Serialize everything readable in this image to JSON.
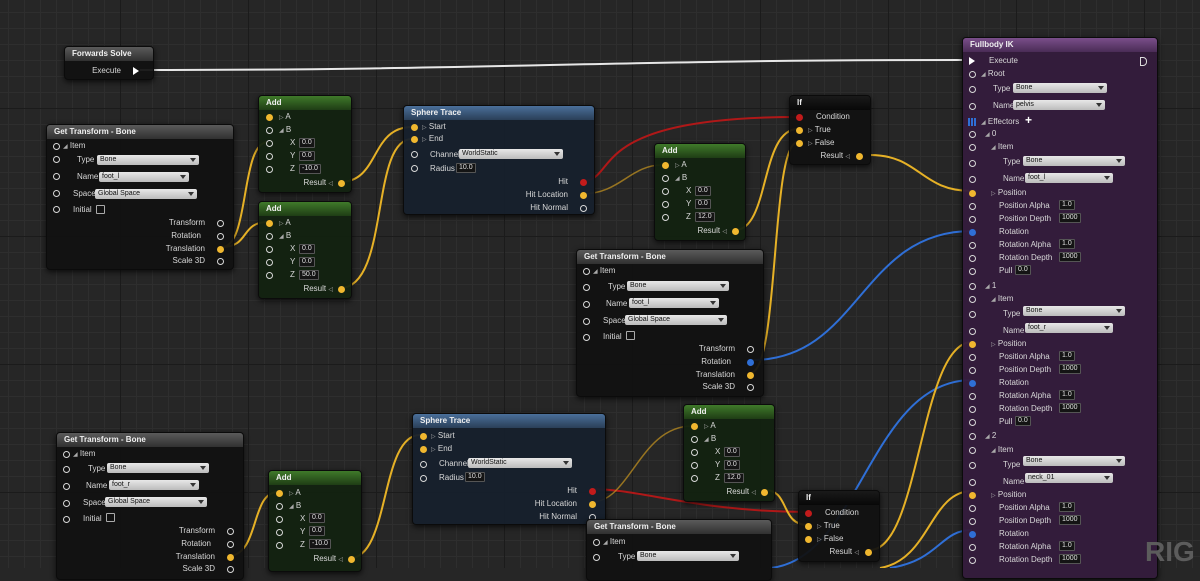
{
  "watermark": "RIG",
  "colors": {
    "exec": "#ffffff",
    "transform": "#e67a2e",
    "rotation": "#2f6fd6",
    "vector": "#f0b72f",
    "bool": "#c21b1b",
    "float": "#9fdc3c",
    "name": "#b45fd8",
    "enum": "#1aa58a"
  },
  "forwards_solve": {
    "title": "Forwards Solve",
    "execute": "Execute"
  },
  "get_transform_1": {
    "title": "Get Transform - Bone",
    "item": "Item",
    "type_label": "Type",
    "type_value": "Bone",
    "name_label": "Name",
    "name_value": "foot_l",
    "space_label": "Space",
    "space_value": "Global Space",
    "initial": "Initial",
    "transform": "Transform",
    "rotation": "Rotation",
    "translation": "Translation",
    "scale": "Scale 3D"
  },
  "add_1": {
    "title": "Add",
    "a": "A",
    "b": "B",
    "x": "X",
    "y": "Y",
    "z": "Z",
    "x_val": "0.0",
    "y_val": "0.0",
    "z_val": "-10.0",
    "result": "Result"
  },
  "add_2": {
    "title": "Add",
    "a": "A",
    "b": "B",
    "x": "X",
    "y": "Y",
    "z": "Z",
    "x_val": "0.0",
    "y_val": "0.0",
    "z_val": "50.0",
    "result": "Result"
  },
  "sphere_trace_1": {
    "title": "Sphere Trace",
    "start": "Start",
    "end": "End",
    "channel_label": "Channel",
    "channel_value": "WorldStatic",
    "radius_label": "Radius",
    "radius_value": "10.0",
    "hit": "Hit",
    "hit_location": "Hit Location",
    "hit_normal": "Hit Normal"
  },
  "add_3": {
    "title": "Add",
    "a": "A",
    "b": "B",
    "x": "X",
    "y": "Y",
    "z": "Z",
    "x_val": "0.0",
    "y_val": "0.0",
    "z_val": "12.0",
    "result": "Result"
  },
  "if_1": {
    "title": "If",
    "condition": "Condition",
    "true": "True",
    "false": "False",
    "result": "Result"
  },
  "get_transform_2": {
    "title": "Get Transform - Bone",
    "item": "Item",
    "type_label": "Type",
    "type_value": "Bone",
    "name_label": "Name",
    "name_value": "foot_l",
    "space_label": "Space",
    "space_value": "Global Space",
    "initial": "Initial",
    "transform": "Transform",
    "rotation": "Rotation",
    "translation": "Translation",
    "scale": "Scale 3D"
  },
  "get_transform_3": {
    "title": "Get Transform - Bone",
    "item": "Item",
    "type_label": "Type",
    "type_value": "Bone",
    "name_label": "Name",
    "name_value": "foot_r",
    "space_label": "Space",
    "space_value": "Global Space",
    "initial": "Initial",
    "transform": "Transform",
    "rotation": "Rotation",
    "translation": "Translation",
    "scale": "Scale 3D"
  },
  "add_4": {
    "title": "Add",
    "a": "A",
    "b": "B",
    "x": "X",
    "y": "Y",
    "z": "Z",
    "x_val": "0.0",
    "y_val": "0.0",
    "z_val": "-10.0",
    "result": "Result"
  },
  "sphere_trace_2": {
    "title": "Sphere Trace",
    "start": "Start",
    "end": "End",
    "channel_label": "Channel",
    "channel_value": "WorldStatic",
    "radius_label": "Radius",
    "radius_value": "10.0",
    "hit": "Hit",
    "hit_location": "Hit Location",
    "hit_normal": "Hit Normal"
  },
  "add_5": {
    "title": "Add",
    "a": "A",
    "b": "B",
    "x": "X",
    "y": "Y",
    "z": "Z",
    "x_val": "0.0",
    "y_val": "0.0",
    "z_val": "12.0",
    "result": "Result"
  },
  "if_2": {
    "title": "If",
    "condition": "Condition",
    "true": "True",
    "false": "False",
    "result": "Result"
  },
  "get_transform_4": {
    "title": "Get Transform - Bone",
    "item": "Item",
    "type_label": "Type",
    "type_value": "Bone"
  },
  "fullbody_ik": {
    "title": "Fullbody IK",
    "execute": "Execute",
    "root": "Root",
    "type_label": "Type",
    "type_value": "Bone",
    "name_label": "Name",
    "name_value": "pelvis",
    "effectors": "Effectors",
    "effectors_list": [
      {
        "index": "0",
        "item": "Item",
        "type_label": "Type",
        "type_value": "Bone",
        "name_label": "Name",
        "name_value": "foot_l",
        "position": "Position",
        "position_alpha": "Position Alpha",
        "position_alpha_val": "1.0",
        "position_depth": "Position Depth",
        "position_depth_val": "1000",
        "rotation": "Rotation",
        "rotation_alpha": "Rotation Alpha",
        "rotation_alpha_val": "1.0",
        "rotation_depth": "Rotation Depth",
        "rotation_depth_val": "1000",
        "pull": "Pull",
        "pull_val": "0.0"
      },
      {
        "index": "1",
        "item": "Item",
        "type_label": "Type",
        "type_value": "Bone",
        "name_label": "Name",
        "name_value": "foot_r",
        "position": "Position",
        "position_alpha": "Position Alpha",
        "position_alpha_val": "1.0",
        "position_depth": "Position Depth",
        "position_depth_val": "1000",
        "rotation": "Rotation",
        "rotation_alpha": "Rotation Alpha",
        "rotation_alpha_val": "1.0",
        "rotation_depth": "Rotation Depth",
        "rotation_depth_val": "1000",
        "pull": "Pull",
        "pull_val": "0.0"
      },
      {
        "index": "2",
        "item": "Item",
        "type_label": "Type",
        "type_value": "Bone",
        "name_label": "Name",
        "name_value": "neck_01",
        "position": "Position",
        "position_alpha": "Position Alpha",
        "position_alpha_val": "1.0",
        "position_depth": "Position Depth",
        "position_depth_val": "1000",
        "rotation": "Rotation",
        "rotation_alpha": "Rotation Alpha",
        "rotation_alpha_val": "1.0",
        "rotation_depth": "Rotation Depth",
        "rotation_depth_val": "1000"
      }
    ]
  }
}
